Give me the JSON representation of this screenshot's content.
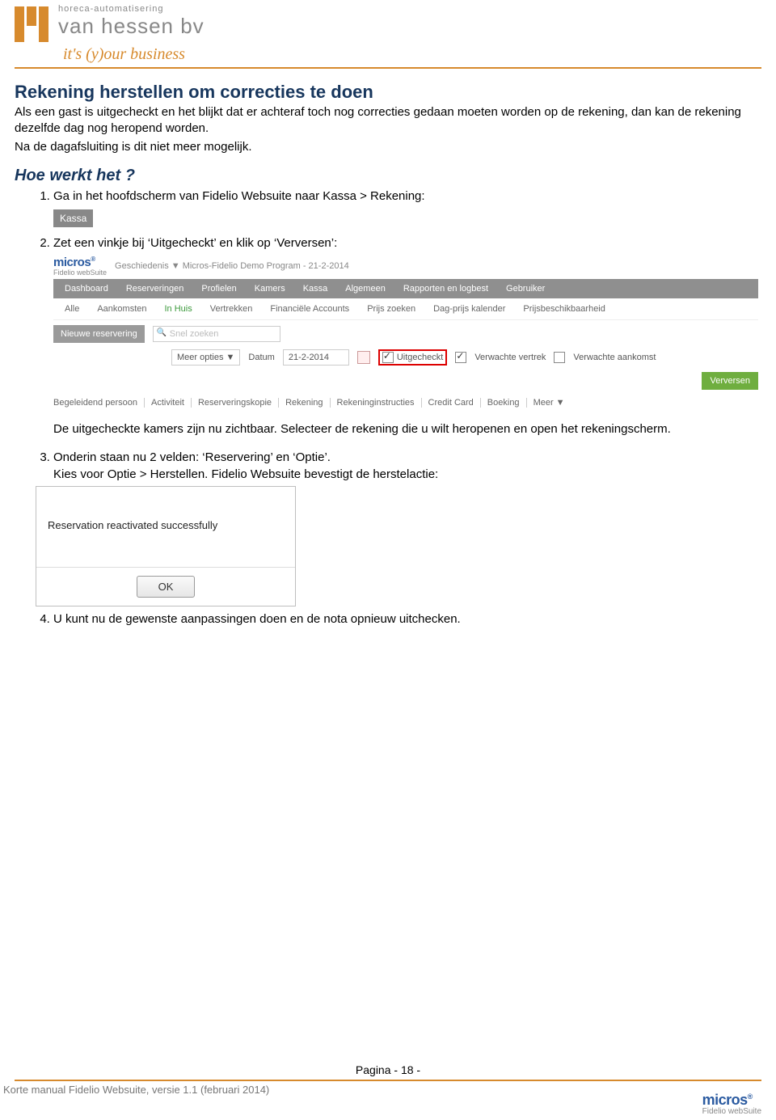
{
  "logo": {
    "sub": "horeca-automatisering",
    "name": "van hessen bv",
    "tagline": "it's (y)our business"
  },
  "section_title": "Rekening herstellen om correcties te doen",
  "intro": "Als een gast is uitgecheckt en het blijkt dat er achteraf toch nog correcties gedaan moeten worden op de rekening, dan kan de rekening dezelfde dag nog heropend worden.",
  "intro2": "Na de dagafsluiting is dit niet meer mogelijk.",
  "how_title": "Hoe werkt het ?",
  "step1": "Ga in het hoofdscherm van Fidelio Websuite naar Kassa > Rekening:",
  "kassa_chip": "Kassa",
  "step2": "Zet een vinkje bij ‘Uitgecheckt’ en klik op ‘Verversen’:",
  "ws": {
    "logo_m": "micros",
    "logo_f": "Fidelio webSuite",
    "crumb": "Geschiedenis ▼ Micros-Fidelio Demo Program - 21-2-2014",
    "nav": [
      "Dashboard",
      "Reserveringen",
      "Profielen",
      "Kamers",
      "Kassa",
      "Algemeen",
      "Rapporten en logbest",
      "Gebruiker"
    ],
    "sub": [
      "Alle",
      "Aankomsten",
      "In Huis",
      "Vertrekken",
      "Financiële Accounts",
      "Prijs zoeken",
      "Dag-prijs kalender",
      "Prijsbeschikbaarheid"
    ],
    "btn_new": "Nieuwe reservering",
    "search_ph": "Snel zoeken",
    "meer": "Meer opties ▼",
    "datum_lbl": "Datum",
    "datum_val": "21-2-2014",
    "chk_uit": "Uitgecheckt",
    "chk_vv": "Verwachte vertrek",
    "chk_va": "Verwachte aankomst",
    "btn_ref": "Verversen",
    "links": [
      "Begeleidend persoon",
      "Activiteit",
      "Reserveringskopie",
      "Rekening",
      "Rekeninginstructies",
      "Credit Card",
      "Boeking",
      "Meer ▼"
    ]
  },
  "step2_sub": "De uitgecheckte kamers zijn nu zichtbaar. Selecteer de rekening die u wilt heropenen en open het rekeningscherm.",
  "step3a": "Onderin staan nu 2 velden:  ‘Reservering’ en ‘Optie’.",
  "step3b": "Kies voor Optie  >  Herstellen. Fidelio Websuite bevestigt de herstelactie:",
  "dialog": {
    "msg": "Reservation reactivated successfully",
    "ok": "OK"
  },
  "step4": "U kunt nu de gewenste aanpassingen doen en de nota opnieuw uitchecken.",
  "footer_page": "Pagina - 18 -",
  "footer_doc": "Korte manual Fidelio Websuite, versie 1.1 (februari 2014)",
  "footer_logo_m": "micros",
  "footer_logo_f": "Fidelio webSuite"
}
